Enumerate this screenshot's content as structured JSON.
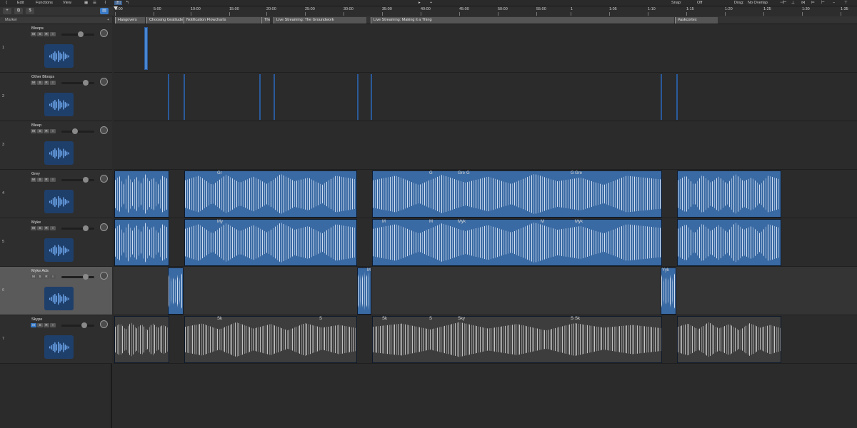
{
  "menubar": {
    "items": [
      "Edit",
      "Functions",
      "View"
    ],
    "center_glyphs": [
      "▸",
      "+"
    ],
    "snap_label": "Snap:",
    "snap_value": "Off",
    "drag_label": "Drag:",
    "drag_value": "No Overlap"
  },
  "toolbar": {
    "add_track": "+",
    "ruler_icon_label": "[B]"
  },
  "marker_header": {
    "label": "Marker",
    "plus": "+"
  },
  "ruler": {
    "labels": [
      "0:00",
      "5:00",
      "10:00",
      "15:00",
      "20:00",
      "25:00",
      "30:00",
      "35:00",
      "40:00",
      "45:00",
      "50:00",
      "55:00",
      "1",
      "1:05",
      "1:10",
      "1:15",
      "1:20",
      "1:25",
      "1:30",
      "1:35"
    ]
  },
  "markers": [
    {
      "label": "Hangovers"
    },
    {
      "label": "Choosing Gratitude"
    },
    {
      "label": "Notification Flowcharts"
    },
    {
      "label": "The"
    },
    {
      "label": "Live Streaming: The Groundwork"
    },
    {
      "label": "Live Streaming: Making it a Thing"
    },
    {
      "label": "#askcortex"
    }
  ],
  "tracks": [
    {
      "num": "1",
      "name": "Bloops",
      "msri": [
        "M",
        "S",
        "R",
        "I"
      ]
    },
    {
      "num": "2",
      "name": "Other Bloops",
      "msri": [
        "M",
        "S",
        "R",
        "I"
      ]
    },
    {
      "num": "3",
      "name": "Bleep",
      "msri": [
        "M",
        "S",
        "R",
        "I"
      ]
    },
    {
      "num": "4",
      "name": "Grey",
      "msri": [
        "M",
        "S",
        "R",
        "I"
      ]
    },
    {
      "num": "5",
      "name": "Myke",
      "msri": [
        "M",
        "S",
        "R",
        "I"
      ]
    },
    {
      "num": "6",
      "name": "Myke Ads",
      "msri": [
        "M",
        "S",
        "R",
        "I"
      ]
    },
    {
      "num": "7",
      "name": "Skype",
      "msri": [
        "M",
        "S",
        "R",
        "I"
      ]
    }
  ],
  "region_tags": {
    "grey": [
      "Gr",
      "G",
      "Gre",
      "G",
      "G",
      "Gre"
    ],
    "myke": [
      "My",
      "M",
      "M",
      "Myk",
      "M",
      "Myk"
    ],
    "ads": [
      "M",
      "Yyk"
    ],
    "skype": [
      "Sk",
      "S",
      "Sk",
      "S",
      "Sky",
      "S",
      "Sk"
    ]
  },
  "colors": {
    "region_blue": "#3a6aa3",
    "mute_active": "#3a7bc8",
    "icon_bg": "#1f3f6b"
  }
}
